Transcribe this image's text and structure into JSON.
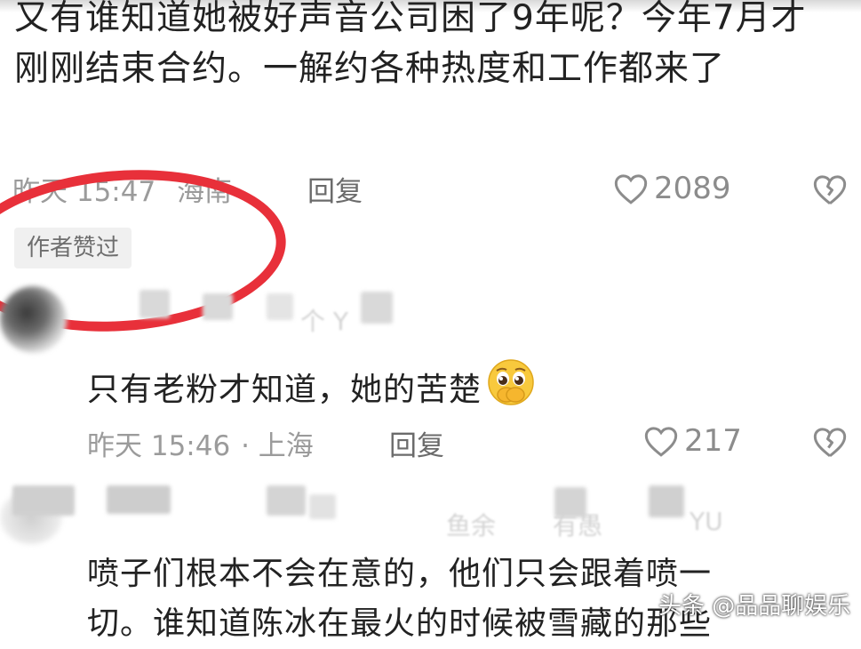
{
  "comment1": {
    "text": "又有谁知道她被好声音公司困了9年呢？今年7月才刚刚结束合约。一解约各种热度和工作都来了",
    "time": "昨天 15:47",
    "location": "海南",
    "reply_label": "回复",
    "likes": "2089",
    "badge": "作者赞过"
  },
  "comment2": {
    "user_fragment": "个 Y",
    "text": "只有老粉才知道，她的苦楚",
    "emoji": "pleading-face",
    "time": "昨天 15:46",
    "location": "上海",
    "reply_label": "回复",
    "likes": "217"
  },
  "comment3": {
    "user_fragment_a": "鱼余",
    "user_fragment_b": "有愚",
    "user_fragment_c": "YU",
    "text_line1": "喷子们根本不会在意的，他们只会跟着喷一",
    "text_line2": "切。谁知道陈冰在最火的时候被雪藏的那些"
  },
  "watermark": "头条 @品品聊娱乐",
  "colors": {
    "highlight_circle": "#e8303a",
    "meta_gray": "#9b9b9b"
  }
}
